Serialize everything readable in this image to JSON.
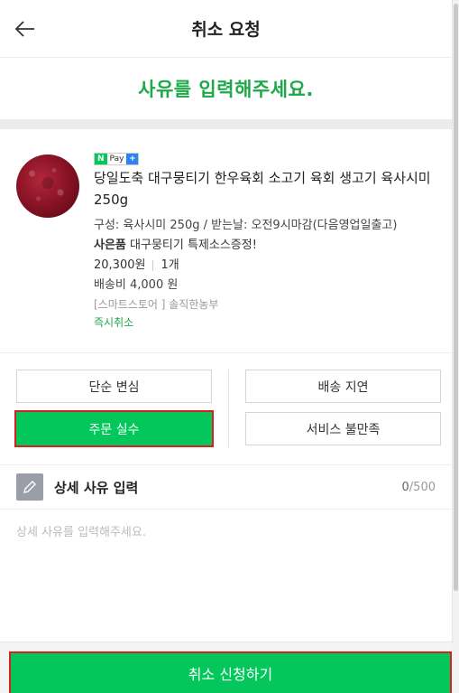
{
  "header": {
    "title": "취소 요청"
  },
  "notice": {
    "text": "사유를 입력해주세요."
  },
  "product": {
    "badge": {
      "n": "N",
      "pay": "Pay",
      "plus": "+"
    },
    "name": "당일도축 대구뭉티기 한우육회 소고기 육회 생고기 육사시미 250g",
    "option": "구성: 육사시미 250g / 받는날: 오전9시마감(다음영업일출고)",
    "gift_label": "사은품",
    "gift_text": " 대구뭉티기 특제소스증정!",
    "price": "20,300원",
    "quantity": "1개",
    "shipping": "배송비 4,000 원",
    "store": "[스마트스토어 ] 솔직한농부",
    "status": "즉시취소"
  },
  "reasons": {
    "left": [
      "단순 변심",
      "주문 실수"
    ],
    "right": [
      "배송 지연",
      "서비스 불만족"
    ],
    "selected": "주문 실수"
  },
  "detail": {
    "title": "상세 사유 입력",
    "count": "0",
    "max": "/500",
    "placeholder": "상세 사유를 입력해주세요."
  },
  "submit": {
    "label": "취소 신청하기"
  },
  "colors": {
    "accent": "#03c75a",
    "notice": "#1ea84a",
    "highlight": "#d91f1f"
  }
}
